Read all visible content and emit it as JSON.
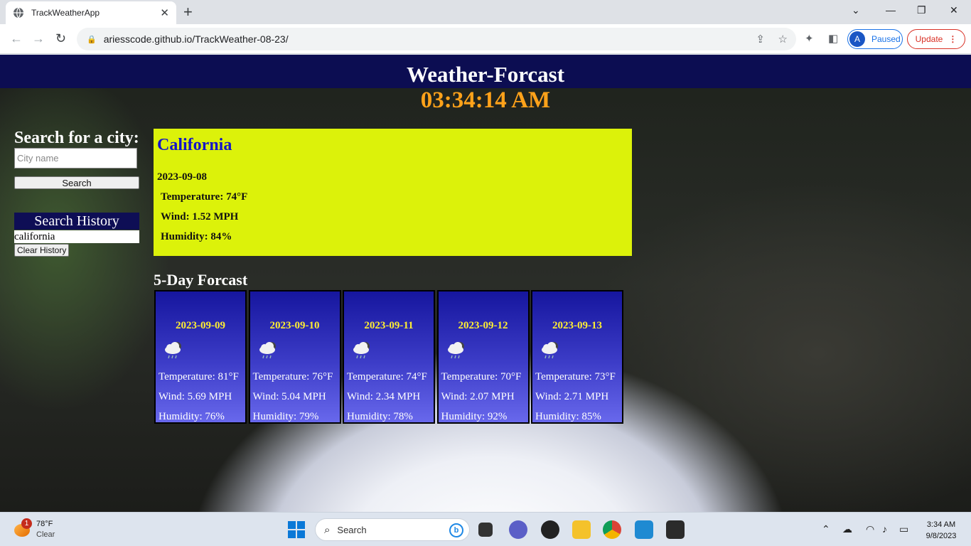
{
  "browser": {
    "tab_title": "TrackWeatherApp",
    "url": "ariesscode.github.io/TrackWeather-08-23/",
    "profile_initial": "A",
    "profile_status": "Paused",
    "update_label": "Update"
  },
  "page": {
    "title": "Weather-Forcast",
    "clock": "03:34:14 AM",
    "search_label": "Search for a city:",
    "search_placeholder": "City name",
    "search_button": "Search",
    "history_title": "Search History",
    "history_items": [
      "california"
    ],
    "clear_button": "Clear History"
  },
  "current": {
    "city": "California",
    "date": "2023-09-08",
    "temperature": "Temperature: 74°F",
    "wind": "Wind: 1.52 MPH",
    "humidity": "Humidity: 84%"
  },
  "forecast": {
    "title": "5-Day Forcast",
    "days": [
      {
        "date": "2023-09-09",
        "icon": "rain-cloud-icon",
        "temperature": "Temperature: 81°F",
        "wind": "Wind: 5.69 MPH",
        "humidity": "Humidity: 76%"
      },
      {
        "date": "2023-09-10",
        "icon": "rain-cloud-icon",
        "temperature": "Temperature: 76°F",
        "wind": "Wind: 5.04 MPH",
        "humidity": "Humidity: 79%"
      },
      {
        "date": "2023-09-11",
        "icon": "rain-cloud-icon",
        "temperature": "Temperature: 74°F",
        "wind": "Wind: 2.34 MPH",
        "humidity": "Humidity: 78%"
      },
      {
        "date": "2023-09-12",
        "icon": "rain-cloud-icon",
        "temperature": "Temperature: 70°F",
        "wind": "Wind: 2.07 MPH",
        "humidity": "Humidity: 92%"
      },
      {
        "date": "2023-09-13",
        "icon": "rain-cloud-icon",
        "temperature": "Temperature: 73°F",
        "wind": "Wind: 2.71 MPH",
        "humidity": "Humidity: 85%"
      }
    ]
  },
  "taskbar": {
    "weather_temp": "78°F",
    "weather_condition": "Clear",
    "weather_badge": "1",
    "search_label": "Search",
    "time": "3:34 AM",
    "date": "9/8/2023"
  },
  "colors": {
    "header_bg": "#0c0d52",
    "clock": "#ffa21a",
    "current_bg": "#dcf20a",
    "city_title": "#1414c8",
    "forecast_date": "#ffee32"
  }
}
